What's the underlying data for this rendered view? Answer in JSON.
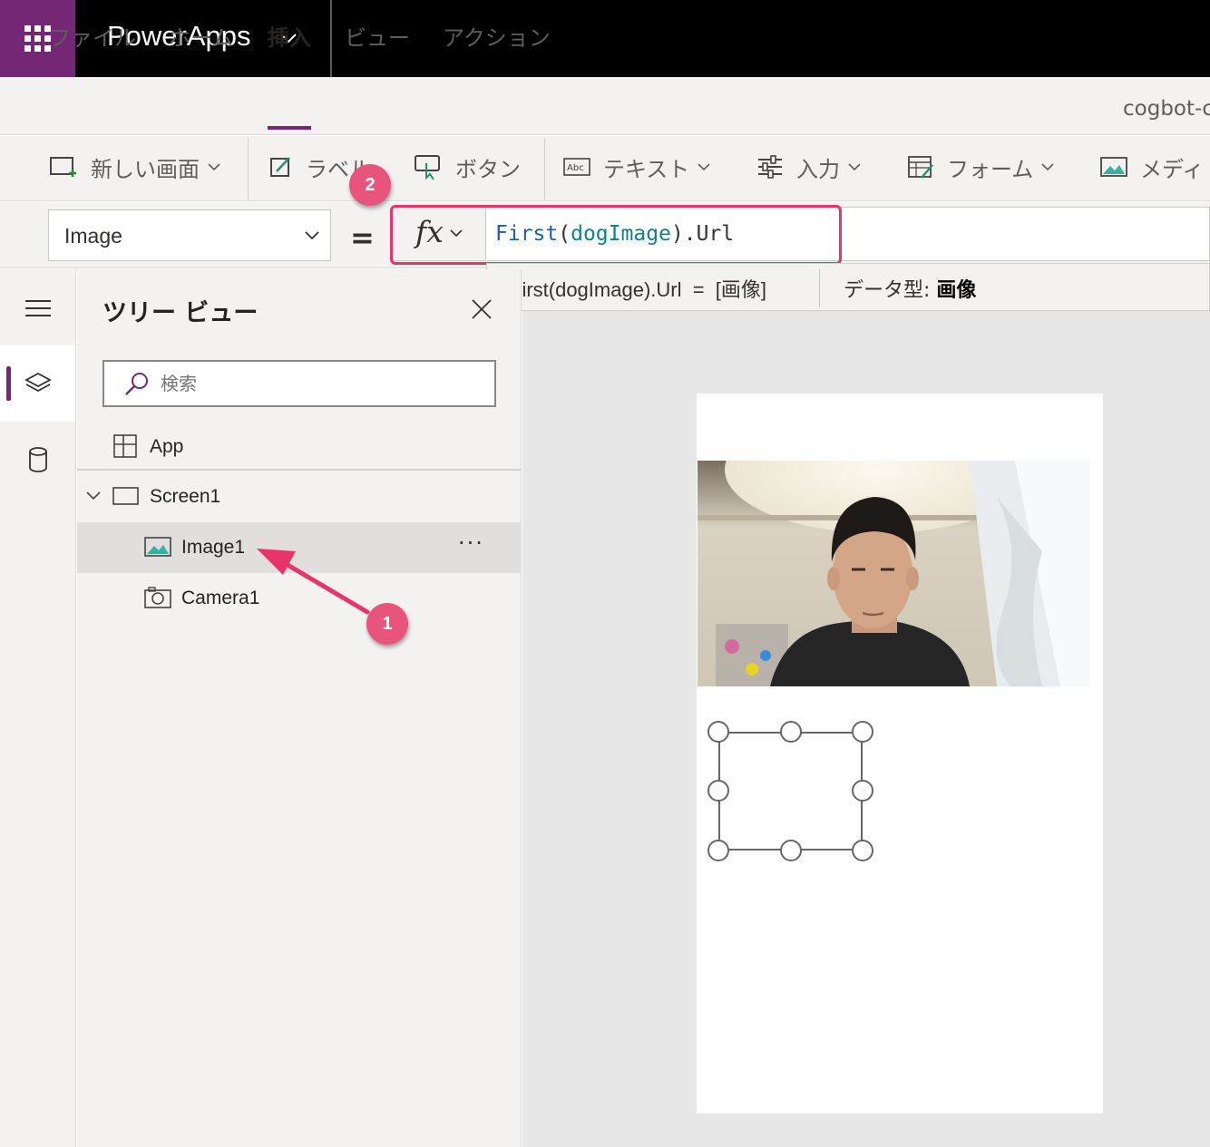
{
  "app": {
    "name": "PowerApps",
    "waffle_icon": "waffle-icon",
    "accent_color": "#742774"
  },
  "menu": {
    "tabs": [
      {
        "label": "ファイル"
      },
      {
        "label": "ホーム"
      },
      {
        "label": "挿入",
        "active": true
      },
      {
        "label": "ビュー"
      },
      {
        "label": "アクション"
      }
    ],
    "right_text": "cogbot-c"
  },
  "ribbon": {
    "new_screen": "新しい画面",
    "label": "ラベル",
    "button": "ボタン",
    "text": "テキスト",
    "input": "入力",
    "form": "フォーム",
    "media": "メディ"
  },
  "formula_bar": {
    "property": "Image",
    "equals": "=",
    "fx": "fx",
    "formula": {
      "fn": "First",
      "open": "(",
      "var": "dogImage",
      "close": ")",
      "rest": ".Url"
    },
    "highlight_color": "#e8336b"
  },
  "formula_result": {
    "expression": "First(dogImage).Url  =  [画像]",
    "datatype_label": "データ型: ",
    "datatype_value": "画像"
  },
  "rail": {
    "items": [
      "hamburger-icon",
      "layers-icon",
      "database-icon"
    ]
  },
  "tree_view": {
    "title": "ツリー ビュー",
    "search_placeholder": "検索",
    "items": [
      {
        "label": "App",
        "icon": "app-icon"
      },
      {
        "label": "Screen1",
        "icon": "screen-icon",
        "expanded": true
      },
      {
        "label": "Image1",
        "icon": "image-icon",
        "selected": true
      },
      {
        "label": "Camera1",
        "icon": "camera-icon"
      }
    ],
    "more": "···"
  },
  "callouts": [
    {
      "number": "1",
      "color": "#e8547c"
    },
    {
      "number": "2",
      "color": "#e8547c"
    }
  ]
}
